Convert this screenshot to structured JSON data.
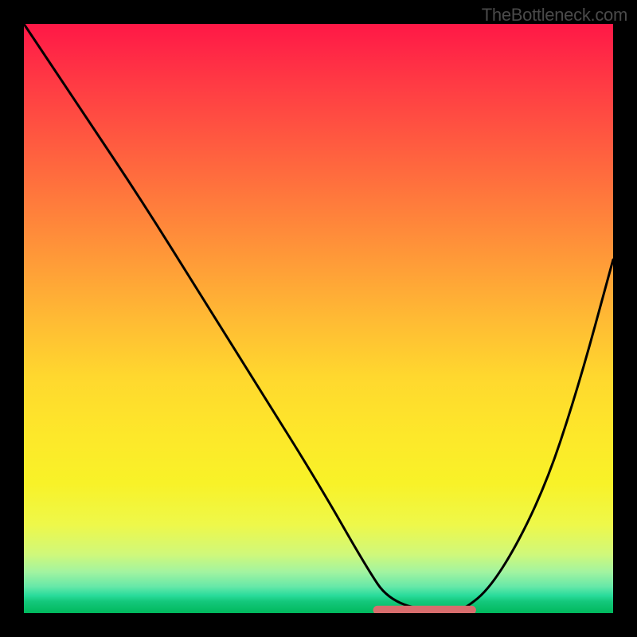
{
  "watermark": "TheBottleneck.com",
  "chart_data": {
    "type": "line",
    "title": "",
    "xlabel": "",
    "ylabel": "",
    "x_range": [
      0,
      100
    ],
    "y_range": [
      0,
      100
    ],
    "series": [
      {
        "name": "bottleneck-curve",
        "x": [
          0,
          10,
          20,
          30,
          40,
          50,
          58,
          62,
          70,
          74,
          80,
          88,
          94,
          100
        ],
        "values": [
          100,
          85,
          70,
          54,
          38,
          22,
          8,
          2,
          0,
          0,
          5,
          20,
          38,
          60
        ]
      }
    ],
    "valley_band": {
      "x_start": 60,
      "x_end": 76,
      "y": 0.5,
      "color": "#d86d6d"
    },
    "background_gradient": {
      "top": "#ff1846",
      "middle": "#ffd82e",
      "bottom": "#00b85c"
    }
  }
}
